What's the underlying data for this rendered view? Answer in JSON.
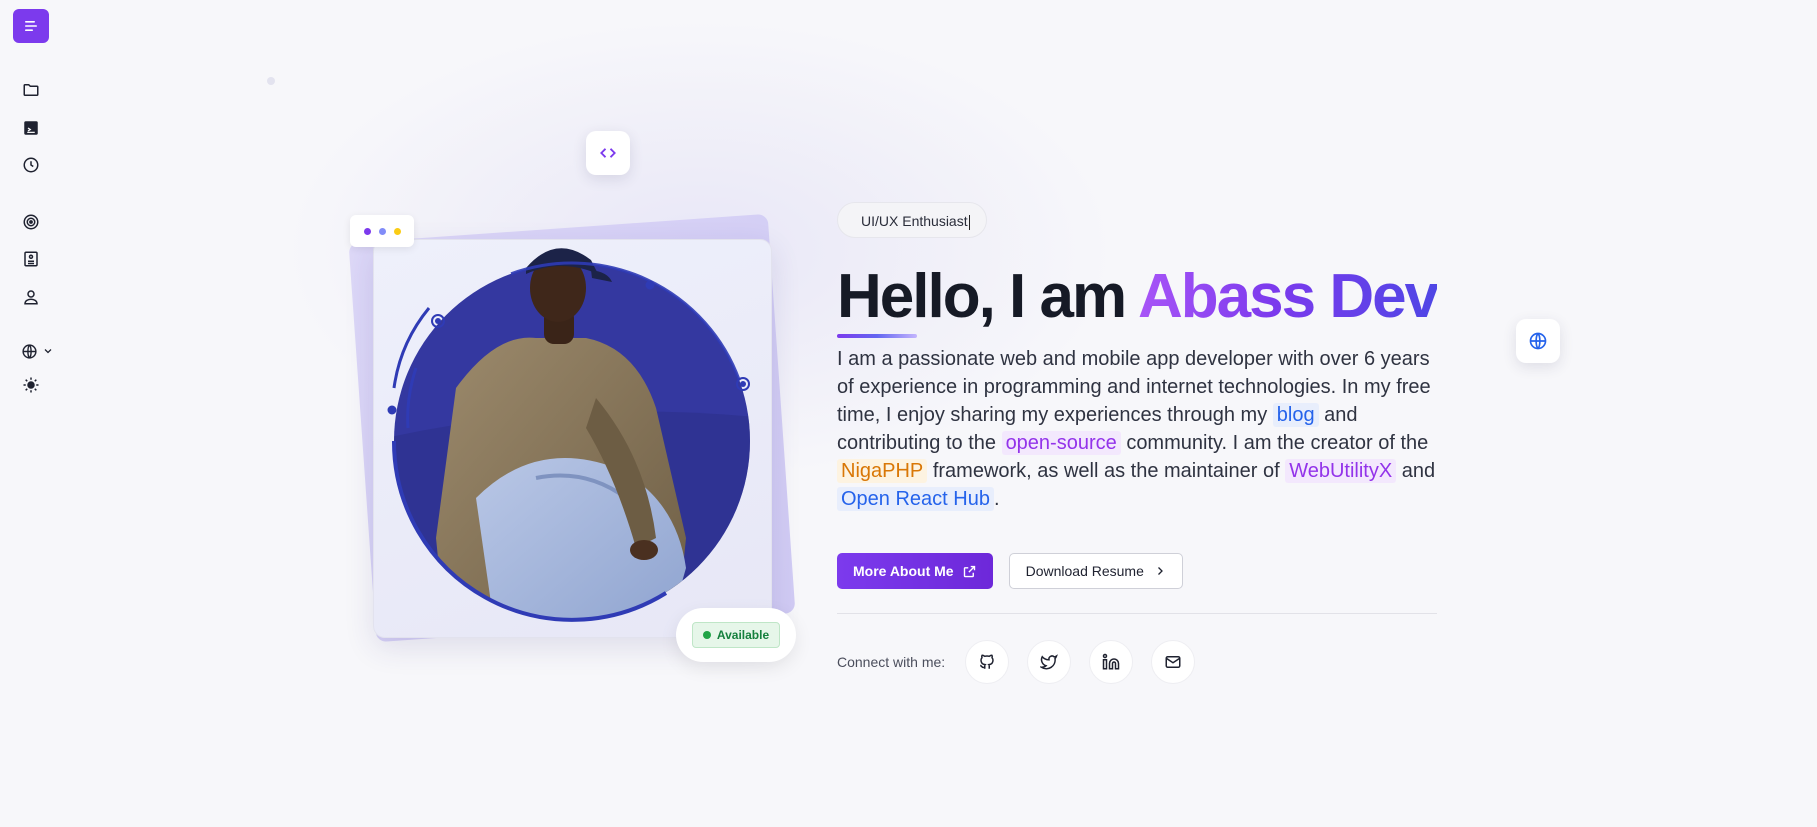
{
  "sidebar": {
    "menu_icon": "menu-icon",
    "items": [
      {
        "icon": "folder-icon"
      },
      {
        "icon": "terminal-icon"
      },
      {
        "icon": "clock-icon"
      },
      {
        "icon": "open-source-icon"
      },
      {
        "icon": "book-icon"
      },
      {
        "icon": "user-icon"
      }
    ],
    "language_icon": "globe-icon",
    "theme_icon": "sun-icon"
  },
  "photo_card": {
    "dot_colors": [
      "#7c3aed",
      "#818cf8",
      "#facc15"
    ],
    "status_badge": "Available"
  },
  "hero": {
    "role": "UI/UX Enthusiast",
    "greeting": "Hello, I am",
    "name": "Abass Dev",
    "bio": {
      "p1": "I am a passionate web and mobile app developer with over 6 years of experience in programming and internet technologies. In my free time, I enjoy sharing my experiences through my",
      "link_blog": "blog",
      "p2": "and contributing to the",
      "link_open_source": "open-source",
      "p3": "community. I am the creator of the",
      "link_nigaphp": "NigaPHP",
      "p4": "framework, as well as the maintainer of",
      "link_webutilityx": "WebUtilityX",
      "p5": "and",
      "link_open_react_hub": "Open React Hub",
      "p6": "."
    },
    "buttons": {
      "more_about": "More About Me",
      "download_resume": "Download Resume"
    },
    "connect_label": "Connect with me:",
    "socials": [
      "github-icon",
      "twitter-icon",
      "linkedin-icon",
      "mail-icon"
    ]
  },
  "colors": {
    "accent": "#7c3aed",
    "link_blue": "#2563eb",
    "link_purple": "#9333ea",
    "link_amber": "#d97706",
    "available_green": "#15803d"
  }
}
